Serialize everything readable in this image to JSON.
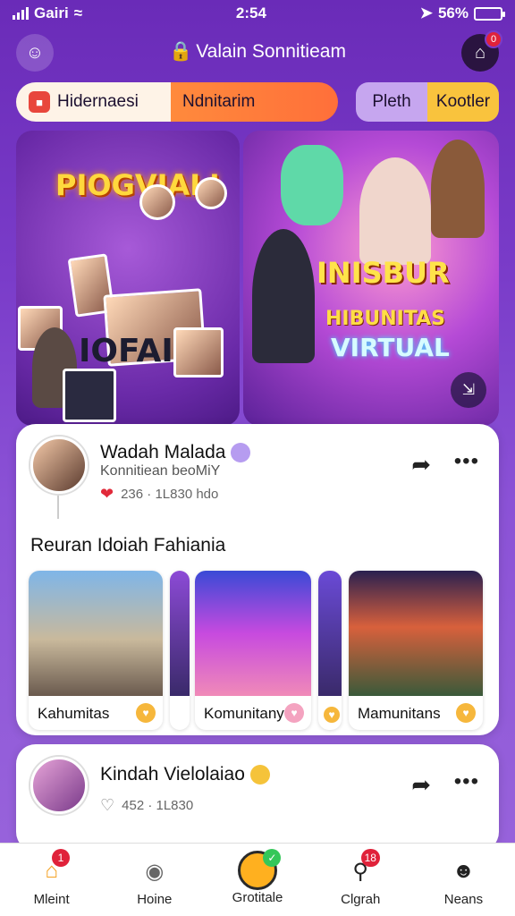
{
  "status_bar": {
    "carrier": "Gairi",
    "time": "2:54",
    "battery": "56%",
    "battery_level": 0.56
  },
  "header": {
    "title": "Valain Sonnitieam",
    "notification_count": "0"
  },
  "segment_tabs": [
    {
      "label": "Hidernaesi"
    },
    {
      "label": "Ndnitarim"
    }
  ],
  "toggle_tabs": [
    {
      "label": "Pleth"
    },
    {
      "label": "Kootler"
    }
  ],
  "hero": {
    "left_title": "PIOGVIAL!",
    "left_subtitle": "IOFAI",
    "right_title": "INISBUR",
    "right_line2": "HIBUNITAS",
    "right_line3": "VIRTUAL"
  },
  "post1": {
    "name": "Wadah Malada",
    "subtitle": "Konnitiean beoMiY",
    "stats": "236 · 1L830 hdo",
    "section_title": "Reuran Idoiah Fahiania",
    "thumbs": [
      {
        "label": "Kahumitas"
      },
      {
        "label": "Komunitany"
      },
      {
        "label": "Mamunitans"
      }
    ]
  },
  "post2": {
    "name": "Kindah Vielolaiao",
    "stats": "452 · 1L830"
  },
  "bottom_nav": [
    {
      "label": "Mleint",
      "badge": "1"
    },
    {
      "label": "Hoine"
    },
    {
      "label": "Grotitale"
    },
    {
      "label": "Clgrah",
      "badge": "18"
    },
    {
      "label": "Neans"
    }
  ]
}
